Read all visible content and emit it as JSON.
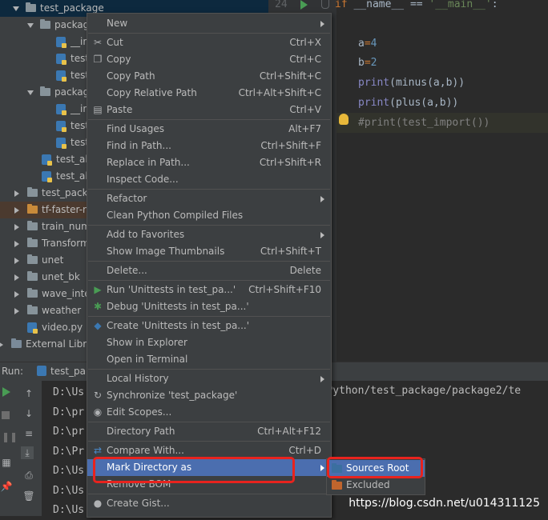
{
  "tree": {
    "items": [
      {
        "label": "test_package",
        "kind": "folder"
      },
      {
        "label": "package",
        "kind": "folder"
      },
      {
        "label": "__ini",
        "kind": "py"
      },
      {
        "label": "test",
        "kind": "py"
      },
      {
        "label": "test",
        "kind": "py"
      },
      {
        "label": "package",
        "kind": "folder"
      },
      {
        "label": "__ini",
        "kind": "py"
      },
      {
        "label": "test",
        "kind": "py"
      },
      {
        "label": "test",
        "kind": "py"
      },
      {
        "label": "test_all",
        "kind": "py"
      },
      {
        "label": "test_all",
        "kind": "py"
      },
      {
        "label": "test_packa",
        "kind": "folder"
      },
      {
        "label": "tf-faster-r",
        "kind": "folder"
      },
      {
        "label": "train_numb",
        "kind": "folder"
      },
      {
        "label": "Transform",
        "kind": "folder"
      },
      {
        "label": "unet",
        "kind": "folder"
      },
      {
        "label": "unet_bk",
        "kind": "folder"
      },
      {
        "label": "wave_inter",
        "kind": "folder"
      },
      {
        "label": "weather",
        "kind": "folder"
      },
      {
        "label": "video.py",
        "kind": "py"
      },
      {
        "label": "External Libra",
        "kind": "lib"
      }
    ]
  },
  "editor": {
    "line_number": "24",
    "lines": [
      {
        "parts": [
          [
            "kw",
            "if "
          ],
          [
            "t",
            "__name__ "
          ],
          [
            "t",
            "== "
          ],
          [
            "str",
            "'__main__'"
          ],
          [
            "t",
            ":"
          ]
        ]
      },
      {
        "parts": [
          [
            "t",
            "a"
          ],
          [
            "t",
            "="
          ],
          [
            "num",
            "4"
          ]
        ]
      },
      {
        "parts": [
          [
            "t",
            "b"
          ],
          [
            "t",
            "="
          ],
          [
            "num",
            "2"
          ]
        ]
      },
      {
        "parts": [
          [
            "fn",
            "print"
          ],
          [
            "t",
            "(minus(a,b))"
          ]
        ]
      },
      {
        "parts": [
          [
            "fn",
            "print"
          ],
          [
            "t",
            "(plus(a,b))"
          ]
        ]
      },
      {
        "parts": [
          [
            "cm",
            "#print(test_import())"
          ]
        ]
      }
    ]
  },
  "run": {
    "label": "Run:",
    "tab": "test_pak",
    "output": [
      "D:\\Us",
      "D:\\pr",
      "D:\\pr",
      "D:\\Pr",
      "D:\\Us",
      "D:\\Us",
      "D:\\Us"
    ],
    "tail_text": "ct/Python/test_package/package2/te"
  },
  "menu": {
    "items": [
      {
        "label": "New",
        "shortcut": "",
        "submenu": true,
        "icon": ""
      },
      {
        "sep": true
      },
      {
        "label": "Cut",
        "shortcut": "Ctrl+X",
        "icon": "scissors-icon"
      },
      {
        "label": "Copy",
        "shortcut": "Ctrl+C",
        "icon": "copy-icon"
      },
      {
        "label": "Copy Path",
        "shortcut": "Ctrl+Shift+C"
      },
      {
        "label": "Copy Relative Path",
        "shortcut": "Ctrl+Alt+Shift+C"
      },
      {
        "label": "Paste",
        "shortcut": "Ctrl+V",
        "icon": "paste-icon"
      },
      {
        "sep": true
      },
      {
        "label": "Find Usages",
        "shortcut": "Alt+F7"
      },
      {
        "label": "Find in Path...",
        "shortcut": "Ctrl+Shift+F"
      },
      {
        "label": "Replace in Path...",
        "shortcut": "Ctrl+Shift+R"
      },
      {
        "label": "Inspect Code...",
        "shortcut": ""
      },
      {
        "sep": true
      },
      {
        "label": "Refactor",
        "shortcut": "",
        "submenu": true
      },
      {
        "label": "Clean Python Compiled Files",
        "shortcut": ""
      },
      {
        "sep": true
      },
      {
        "label": "Add to Favorites",
        "shortcut": "",
        "submenu": true
      },
      {
        "label": "Show Image Thumbnails",
        "shortcut": "Ctrl+Shift+T"
      },
      {
        "sep": true
      },
      {
        "label": "Delete...",
        "shortcut": "Delete"
      },
      {
        "sep": true
      },
      {
        "label": "Run 'Unittests in test_pa...'",
        "shortcut": "Ctrl+Shift+F10",
        "icon": "run-icon"
      },
      {
        "label": "Debug 'Unittests in test_pa...'",
        "shortcut": "",
        "icon": "debug-icon"
      },
      {
        "sep": true
      },
      {
        "label": "Create 'Unittests in test_pa...'",
        "shortcut": "",
        "icon": "python-icon"
      },
      {
        "label": "Show in Explorer",
        "shortcut": ""
      },
      {
        "label": "Open in Terminal",
        "shortcut": ""
      },
      {
        "sep": true
      },
      {
        "label": "Local History",
        "shortcut": "",
        "submenu": true
      },
      {
        "label": "Synchronize 'test_package'",
        "shortcut": "",
        "icon": "sync-icon"
      },
      {
        "label": "Edit Scopes...",
        "shortcut": "",
        "icon": "scope-icon"
      },
      {
        "sep": true
      },
      {
        "label": "Directory Path",
        "shortcut": "Ctrl+Alt+F12"
      },
      {
        "sep": true
      },
      {
        "label": "Compare With...",
        "shortcut": "Ctrl+D",
        "icon": "compare-icon"
      },
      {
        "label": "Mark Directory as",
        "shortcut": "",
        "submenu": true,
        "active": true
      },
      {
        "label": "Remove BOM",
        "shortcut": ""
      },
      {
        "sep": true
      },
      {
        "label": "Create Gist...",
        "shortcut": "",
        "icon": "github-icon"
      }
    ]
  },
  "submenu": {
    "items": [
      {
        "label": "Sources Root",
        "color": "#3b6fa0"
      },
      {
        "label": "Excluded",
        "color": "#c0652d"
      }
    ]
  },
  "watermark": "https://blog.csdn.net/u014311125",
  "colors": {
    "highlight": "#e8231e",
    "menu_active": "#4b6eaf"
  }
}
